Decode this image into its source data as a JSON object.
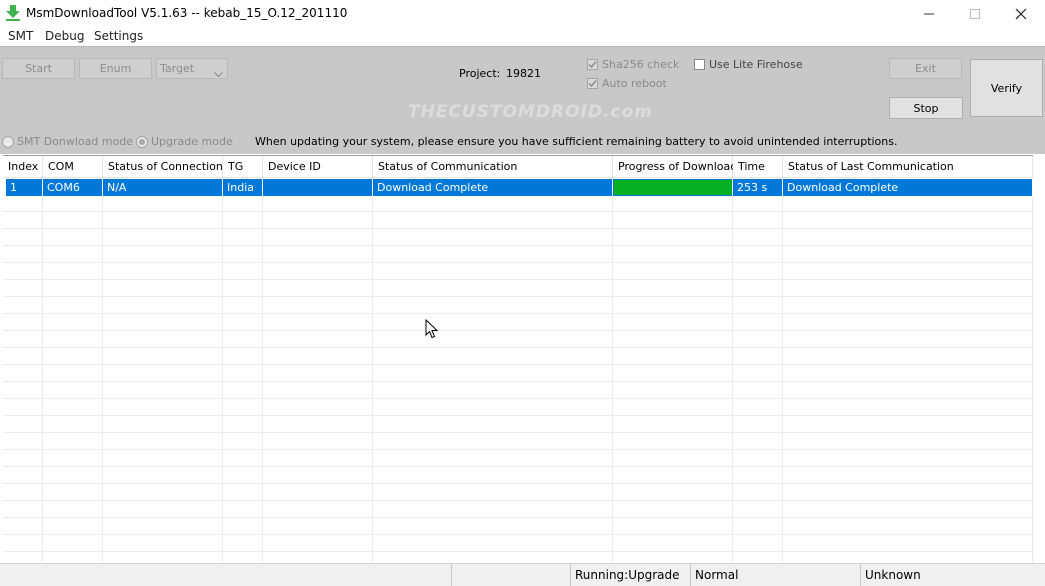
{
  "window": {
    "title": "MsmDownloadTool V5.1.63 -- kebab_15_O.12_201110",
    "icon": "download-arrow-icon",
    "controls": [
      "minimize-icon",
      "maximize-icon",
      "close-icon"
    ]
  },
  "menu": {
    "items": [
      "SMT",
      "Debug",
      "Settings"
    ]
  },
  "toolbar": {
    "start_label": "Start",
    "enum_label": "Enum",
    "target_value": "Target",
    "project_label": "Project:",
    "project_value": "19821",
    "sha256_label": "Sha256 check",
    "sha256_checked": true,
    "auto_reboot_label": "Auto reboot",
    "auto_reboot_checked": true,
    "lite_firehose_label": "Use Lite Firehose",
    "lite_firehose_checked": false,
    "exit_label": "Exit",
    "stop_label": "Stop",
    "verify_label": "Verify",
    "watermark": "THECUSTOMDROID.com"
  },
  "modes": {
    "smt_label": "SMT Donwload mode",
    "smt_selected": false,
    "upgrade_label": "Upgrade mode",
    "upgrade_selected": true,
    "notice": "When updating your system, please ensure you have sufficient remaining battery to avoid unintended interruptions."
  },
  "grid": {
    "headers": [
      "Index",
      "COM",
      "Status of Connection",
      "TG",
      "Device ID",
      "Status of Communication",
      "Progress of Download",
      "Time",
      "Status of Last Communication"
    ],
    "rows": [
      {
        "index": "1",
        "com": "COM6",
        "connection": "N/A",
        "tg": "India",
        "device_id": "",
        "communication": "Download Complete",
        "progress": 1.0,
        "time": "253 s",
        "last_communication": "Download Complete"
      }
    ],
    "selection_color": "#0078d7",
    "progress_color": "#06b025"
  },
  "statusbar": {
    "panels": [
      "",
      "",
      "Running:Upgrade",
      "Normal",
      "Unknown"
    ]
  }
}
